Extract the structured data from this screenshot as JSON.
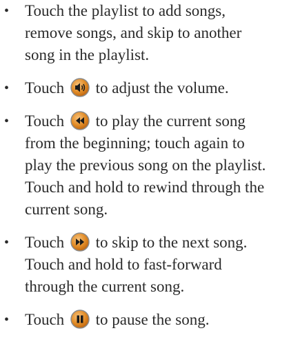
{
  "bullet_char": "•",
  "items": [
    {
      "lines": [
        "Touch the playlist to add songs,",
        "remove songs, and skip to another",
        "song in the playlist."
      ]
    },
    {
      "before_icon": "Touch",
      "icon": "volume-icon",
      "after_icon": "to adjust the volume."
    },
    {
      "before_icon": "Touch",
      "icon": "rewind-icon",
      "after_icon": "to play the current song",
      "lines": [
        "from the beginning; touch again to",
        "play the previous song on the playlist.",
        "Touch and hold to rewind through the",
        "current song."
      ]
    },
    {
      "before_icon": "Touch",
      "icon": "fast-forward-icon",
      "after_icon": "to skip to the next song.",
      "lines": [
        "Touch and hold to fast-forward",
        "through the current song."
      ]
    },
    {
      "before_icon": "Touch",
      "icon": "pause-icon",
      "after_icon": "to pause the song."
    }
  ],
  "colors": {
    "text": "#2a2a2a",
    "icon_fill": "#d07a1a",
    "icon_ring": "#8a8a8a",
    "icon_glyph": "#1a1a1a"
  }
}
